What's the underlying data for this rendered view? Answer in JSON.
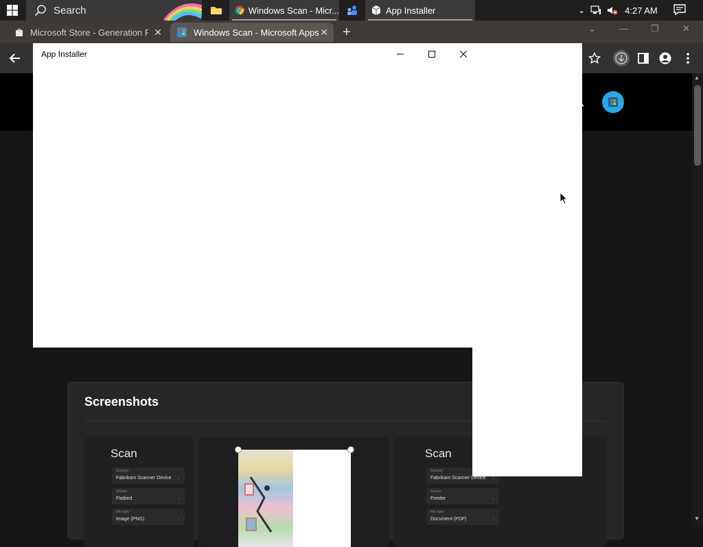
{
  "taskbar": {
    "search_placeholder": "Search",
    "apps": [
      {
        "name": "file-explorer",
        "label": ""
      },
      {
        "name": "chrome",
        "label": "Windows Scan - Micr..."
      },
      {
        "name": "app-generic",
        "label": ""
      },
      {
        "name": "app-installer",
        "label": "App Installer"
      }
    ],
    "clock": "4:27 AM"
  },
  "browser": {
    "tabs": [
      {
        "label": "Microsoft Store - Generation Pro",
        "active": false
      },
      {
        "label": "Windows Scan - Microsoft Apps",
        "active": true
      }
    ],
    "new_tab": "+",
    "window_controls": [
      "⌄",
      "—",
      "❐",
      "✕"
    ]
  },
  "installer": {
    "title": "App Installer"
  },
  "page": {
    "screenshots_heading": "Screenshots",
    "shot1": {
      "title": "Scan",
      "fields": [
        {
          "key": "Scanner",
          "value": "Fabrikam Scanner Device"
        },
        {
          "key": "Source",
          "value": "Flatbed"
        },
        {
          "key": "File type",
          "value": "Image (PNG)"
        }
      ]
    },
    "shot3": {
      "title": "Scan",
      "fields": [
        {
          "key": "Scanner",
          "value": "Fabrikam Scanner Device"
        },
        {
          "key": "Source",
          "value": "Feeder"
        },
        {
          "key": "File type",
          "value": "Document (PDF)"
        }
      ]
    }
  },
  "colors": {
    "taskbar_bg": "#1f1f1f",
    "tabstrip_bg": "#3d3a37",
    "active_tab_bg": "#5a5652",
    "toolbar_bg": "#333130",
    "page_bg": "#161616",
    "card_bg": "#262628",
    "store_accent": "#29a8e0"
  }
}
